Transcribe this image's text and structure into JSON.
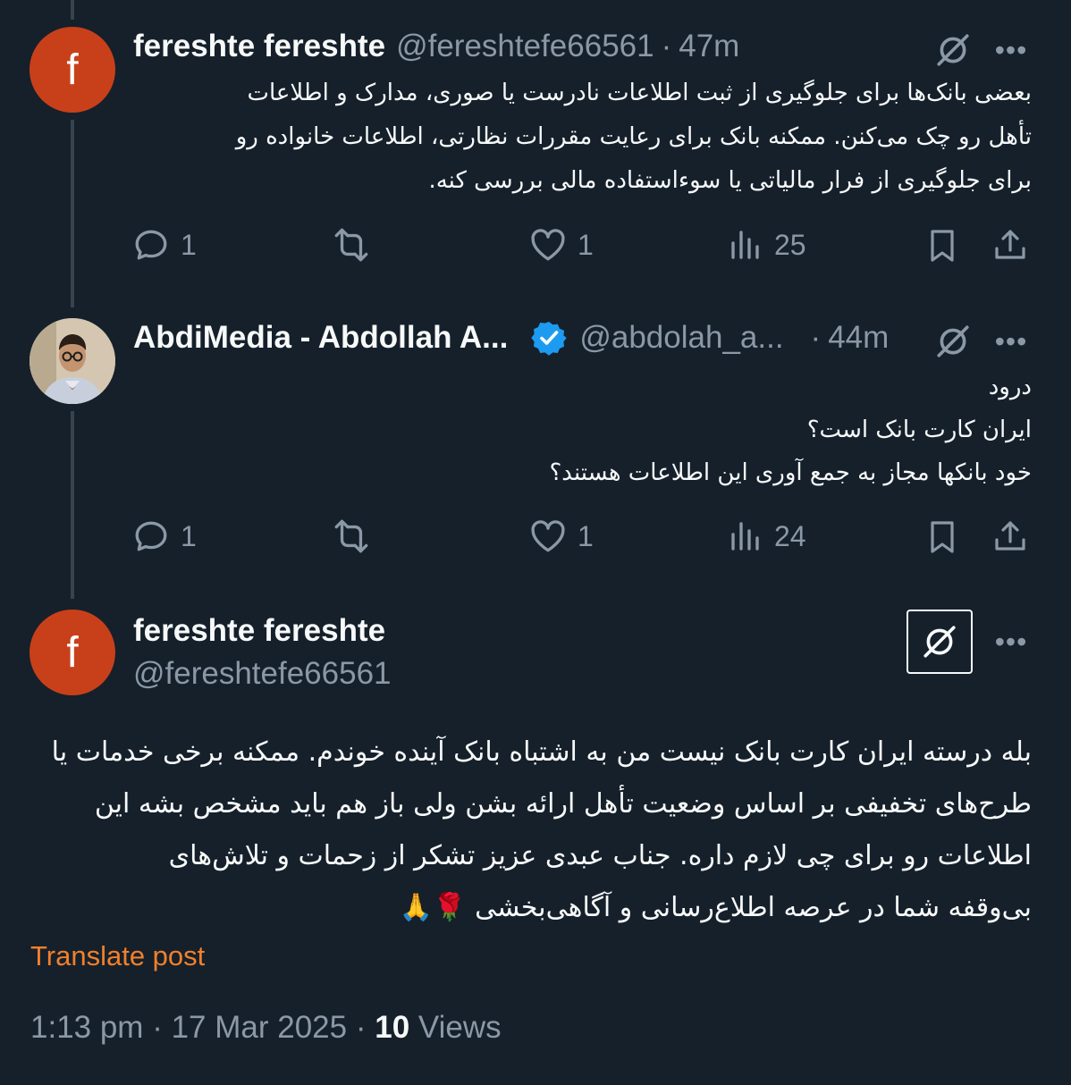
{
  "posts": [
    {
      "name": "fereshte fereshte",
      "handle": "@fereshtefe66561",
      "separator": "·",
      "time": "47m",
      "avatar_letter": "f",
      "text": "بعضی بانک‌ها برای جلوگیری از ثبت اطلاعات نادرست یا صوری، مدارک و اطلاعات\nتأهل رو چک می‌کنن. ممکنه بانک برای رعایت مقررات نظارتی، اطلاعات خانواده رو\nبرای جلوگیری از فرار مالیاتی یا سوءاستفاده مالی بررسی کنه.",
      "replies": "1",
      "likes": "1",
      "views": "25"
    },
    {
      "name": "AbdiMedia - Abdollah A...",
      "handle": "@abdolah_a...",
      "separator": "·",
      "time": "44m",
      "verified": true,
      "text": "درود\nایران کارت بانک است؟\nخود بانکها مجاز  به جمع آوری این اطلاعات هستند؟",
      "replies": "1",
      "likes": "1",
      "views": "24"
    }
  ],
  "main_post": {
    "name": "fereshte fereshte",
    "handle": "@fereshtefe66561",
    "avatar_letter": "f",
    "text": "بله درسته ایران کارت بانک نیست من به اشتباه بانک آینده خوندم. ممکنه برخی خدمات یا\nطرح‌های تخفیفی بر اساس وضعیت تأهل ارائه بشن ولی باز هم باید مشخص بشه این\nاطلاعات رو برای چی لازم داره. جناب عبدی عزیز تشکر از زحمات و تلاش‌های\nبی‌وقفه شما در عرصه اطلاع‌رسانی و آگاهی‌بخشی 🌹🙏",
    "translate_label": "Translate post",
    "time": "1:13 pm",
    "date": "17 Mar 2025",
    "separator": "·",
    "views_count": "10",
    "views_label": "Views"
  },
  "icons": {
    "more": "more-horizontal-icon",
    "grok": "grok-slash-icon",
    "reply": "reply-icon",
    "repost": "repost-icon",
    "like": "heart-icon",
    "views": "views-chart-icon",
    "bookmark": "bookmark-icon",
    "share": "share-icon",
    "verified": "verified-badge-icon"
  },
  "colors": {
    "background": "#15202b",
    "text": "#f7f9f9",
    "muted": "#8b98a5",
    "verified": "#1d9bf0",
    "translate": "#f2802b",
    "avatar": "#c8401a"
  },
  "more_label": "•••"
}
